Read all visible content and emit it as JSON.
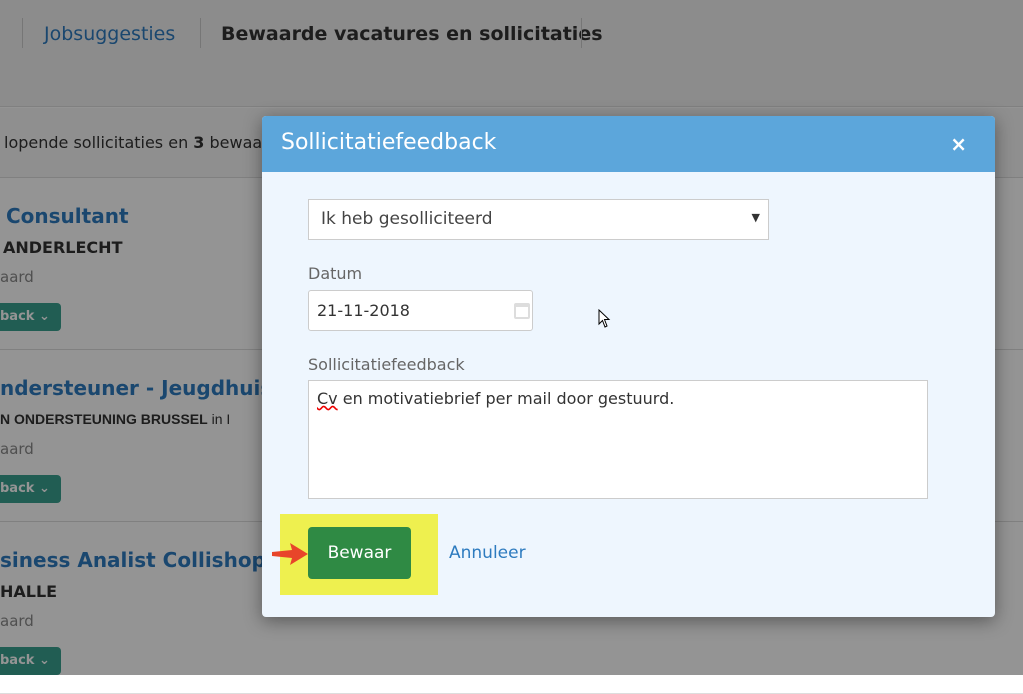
{
  "nav": {
    "tabs": [
      "Jobsuggesties",
      "Bewaarde vacatures en sollicitaties"
    ]
  },
  "summary": {
    "prefix": "lopende sollicitaties en ",
    "count": "3",
    "suffix": " bewaa"
  },
  "jobs": [
    {
      "title": "Consultant",
      "company": "ANDERLECHT",
      "company_suffix": "",
      "status": "aard",
      "button": "back"
    },
    {
      "title": "ndersteuner - Jeugdhuison",
      "company": "N ONDERSTEUNING BRUSSEL",
      "company_suffix": " in I",
      "status": "aard",
      "button": "back"
    },
    {
      "title": "siness Analist Collishop",
      "company": "HALLE",
      "company_suffix": "",
      "status": "aard",
      "button": "back"
    }
  ],
  "modal": {
    "title": "Sollicitatiefeedback",
    "close": "×",
    "status_select": "Ik heb gesolliciteerd",
    "date_label": "Datum",
    "date_value": "21-11-2018",
    "feedback_label": "Sollicitatiefeedback",
    "feedback_first": "Cv",
    "feedback_rest": " en motivatiebrief per mail door gestuurd.",
    "save": "Bewaar",
    "cancel": "Annuleer"
  },
  "colors": {
    "header": "#5ca6db",
    "save": "#2f8a44",
    "highlight": "#eef04f",
    "link": "#2d7bbf"
  }
}
